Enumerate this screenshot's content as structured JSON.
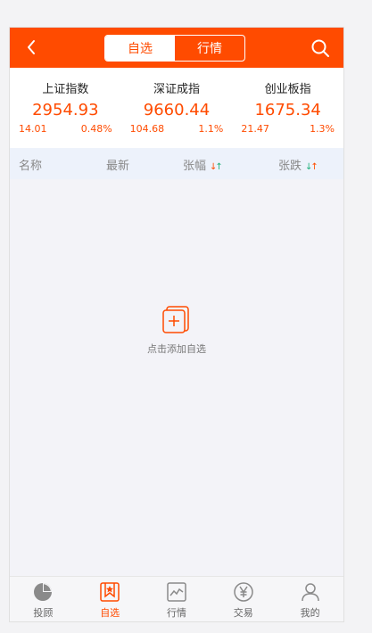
{
  "header": {
    "tabs": [
      {
        "label": "自选",
        "active": true
      },
      {
        "label": "行情",
        "active": false
      }
    ],
    "back_icon": "chevron-left-icon",
    "search_icon": "search-icon",
    "accent_color": "#ff4b00"
  },
  "indices": [
    {
      "name": "上证指数",
      "price": "2954.93",
      "change": "14.01",
      "percent": "0.48%"
    },
    {
      "name": "深证成指",
      "price": "9660.44",
      "change": "104.68",
      "percent": "1.1%"
    },
    {
      "name": "创业板指",
      "price": "1675.34",
      "change": "21.47",
      "percent": "1.3%"
    }
  ],
  "columns": {
    "name": "名称",
    "latest": "最新",
    "up": "张幅",
    "down": "张跌"
  },
  "empty_state": {
    "icon": "add-favorite-icon",
    "text": "点击添加自选"
  },
  "tabbar": [
    {
      "label": "投顾",
      "icon": "pie-chart-icon",
      "active": false
    },
    {
      "label": "自选",
      "icon": "bookmark-star-icon",
      "active": true
    },
    {
      "label": "行情",
      "icon": "line-chart-icon",
      "active": false
    },
    {
      "label": "交易",
      "icon": "yen-icon",
      "active": false
    },
    {
      "label": "我的",
      "icon": "user-icon",
      "active": false
    }
  ]
}
